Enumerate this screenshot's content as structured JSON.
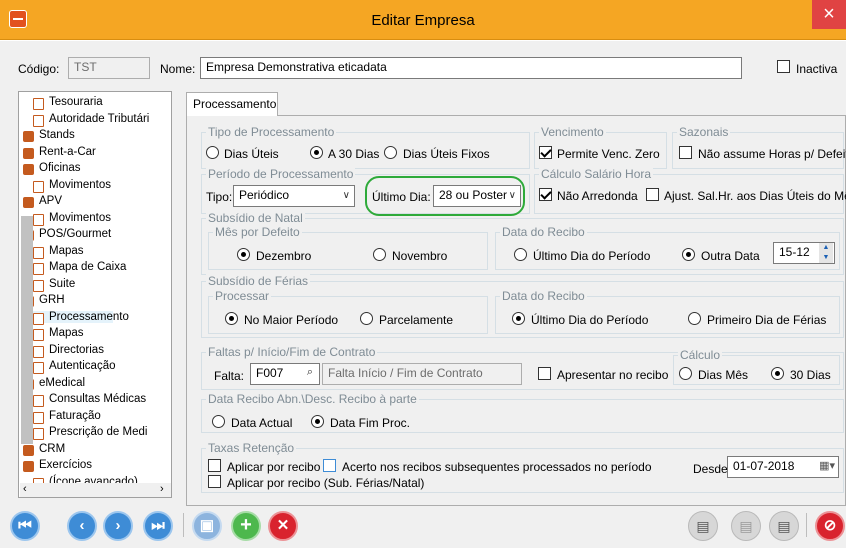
{
  "window": {
    "title": "Editar Empresa",
    "close": "×"
  },
  "header": {
    "codigo_label": "Código:",
    "codigo_value": "TST",
    "nome_label": "Nome:",
    "nome_value": "Empresa Demonstrativa eticadata",
    "inactiva_label": "Inactiva"
  },
  "tree": {
    "items": [
      {
        "label": "Tesouraria",
        "type": "doc",
        "level": 1
      },
      {
        "label": "Autoridade Tributári",
        "type": "doc",
        "level": 1
      },
      {
        "label": "Stands",
        "type": "node",
        "level": 0
      },
      {
        "label": "Rent-a-Car",
        "type": "node",
        "level": 0
      },
      {
        "label": "Oficinas",
        "type": "node",
        "level": 0
      },
      {
        "label": "Movimentos",
        "type": "doc",
        "level": 1
      },
      {
        "label": "APV",
        "type": "node",
        "level": 0
      },
      {
        "label": "Movimentos",
        "type": "doc",
        "level": 1
      },
      {
        "label": "POS/Gourmet",
        "type": "node",
        "level": 0
      },
      {
        "label": "Mapas",
        "type": "doc",
        "level": 1
      },
      {
        "label": "Mapa de Caixa",
        "type": "doc",
        "level": 1
      },
      {
        "label": "Suite",
        "type": "doc",
        "level": 1
      },
      {
        "label": "GRH",
        "type": "node",
        "level": 0
      },
      {
        "label": "Processamento",
        "type": "doc",
        "level": 1,
        "selected": true
      },
      {
        "label": "Mapas",
        "type": "doc",
        "level": 1
      },
      {
        "label": "Directorias",
        "type": "doc",
        "level": 1
      },
      {
        "label": "Autenticação",
        "type": "doc",
        "level": 1
      },
      {
        "label": "eMedical",
        "type": "node",
        "level": 0
      },
      {
        "label": "Consultas Médicas",
        "type": "doc",
        "level": 1
      },
      {
        "label": "Faturação",
        "type": "doc",
        "level": 1
      },
      {
        "label": "Prescrição de Medi",
        "type": "doc",
        "level": 1
      },
      {
        "label": "CRM",
        "type": "node",
        "level": 0
      },
      {
        "label": "Exercícios",
        "type": "node",
        "level": 0
      },
      {
        "label": "(Ícone avançado)",
        "type": "doc",
        "level": 1
      }
    ]
  },
  "tab": {
    "label": "Processamento"
  },
  "tipo_proc": {
    "title": "Tipo de Processamento",
    "opt1": "Dias Úteis",
    "opt2": "A 30 Dias",
    "opt3": "Dias Úteis Fixos",
    "selected": "A 30 Dias"
  },
  "vencimento": {
    "title": "Vencimento",
    "permite": "Permite Venc. Zero"
  },
  "sazonais": {
    "title": "Sazonais",
    "nao_assume": "Não assume Horas p/ Defeito"
  },
  "periodo": {
    "title": "Período de Processamento",
    "tipo_label": "Tipo:",
    "tipo_value": "Periódico",
    "ultimo_label": "Último Dia:",
    "ultimo_value": "28 ou Poster"
  },
  "calculo_hora": {
    "title": "Cálculo Salário Hora",
    "nao_arredonda": "Não Arredonda",
    "ajust": "Ajust. Sal.Hr. aos Dias Úteis do Mês"
  },
  "natal": {
    "title": "Subsídio de Natal",
    "mes_title": "Mês por Defeito",
    "dez": "Dezembro",
    "nov": "Novembro",
    "recibo_title": "Data do Recibo",
    "ultimo": "Último Dia do Período",
    "outra": "Outra Data",
    "outra_value": "15-12"
  },
  "ferias": {
    "title": "Subsídio de Férias",
    "proc_title": "Processar",
    "maior": "No Maior Período",
    "parcel": "Parcelamente",
    "recibo_title": "Data do Recibo",
    "ultimo": "Último Dia do Período",
    "primeiro": "Primeiro Dia de Férias"
  },
  "faltas": {
    "title": "Faltas p/ Início/Fim de Contrato",
    "falta_label": "Falta:",
    "falta_value": "F007",
    "falta_desc": "Falta Início / Fim de Contrato",
    "apresentar": "Apresentar no recibo",
    "calc_title": "Cálculo",
    "dias_mes": "Dias Mês",
    "trinta": "30 Dias"
  },
  "data_recibo": {
    "title": "Data Recibo Abn.\\Desc. Recibo à parte",
    "actual": "Data Actual",
    "fim": "Data Fim Proc."
  },
  "taxas": {
    "title": "Taxas Retenção",
    "aplicar": "Aplicar por recibo",
    "acerto": "Acerto nos recibos subsequentes processados no período",
    "aplicar_sub": "Aplicar por recibo (Sub. Férias/Natal)",
    "desde_label": "Desde:",
    "desde_value": "01-07-2018"
  },
  "toolbar": {
    "first": "⏮",
    "prev": "‹",
    "next": "›",
    "last": "⏭",
    "save": "▣",
    "add": "+",
    "delete": "✕"
  },
  "colors": {
    "titlebar": "#F5A623",
    "accent": "#3E8CD6",
    "highlight": "#2EAA3A",
    "delete": "#D9232E",
    "add": "#3BA93B"
  }
}
